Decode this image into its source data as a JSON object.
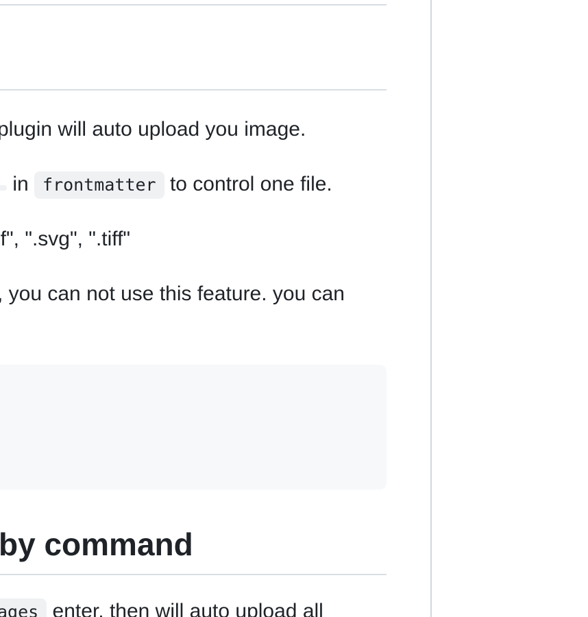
{
  "readme": {
    "line1": "plugin will auto upload you image.",
    "line2": {
      "pre_code_fragment": " ",
      "in_text": " in ",
      "code": "frontmatter",
      "after": " to control one file."
    },
    "line3": "if\", \".svg\", \".tiff\"",
    "line4": ", you can not use this feature. you can",
    "heading": "by command",
    "line5": {
      "code_fragment": "ages",
      "after": "  enter, then will auto upload all"
    }
  }
}
